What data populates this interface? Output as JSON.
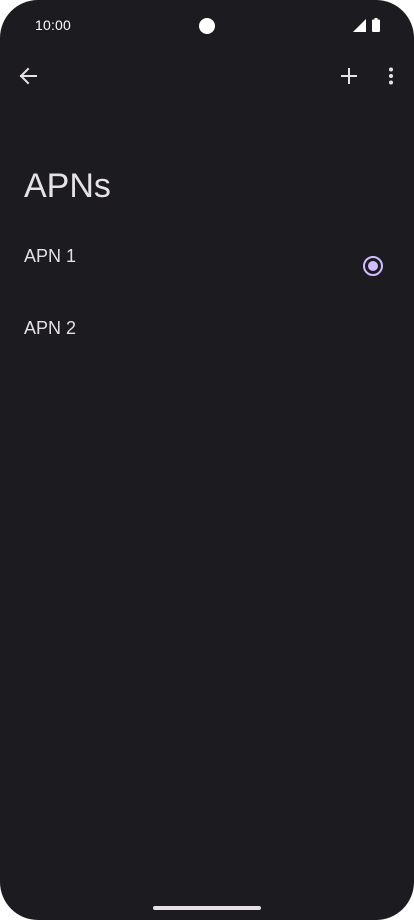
{
  "status_bar": {
    "time": "10:00",
    "icons": [
      "signal-icon",
      "battery-icon"
    ]
  },
  "app_bar": {
    "back_icon": "arrow-back-icon",
    "add_icon": "plus-icon",
    "more_icon": "more-vert-icon"
  },
  "page": {
    "title": "APNs"
  },
  "apns": [
    {
      "label": "APN 1",
      "selected": true
    },
    {
      "label": "APN 2",
      "selected": false
    }
  ],
  "colors": {
    "background": "#1c1b20",
    "text": "#e6e1e5",
    "accent": "#d0bcff"
  }
}
